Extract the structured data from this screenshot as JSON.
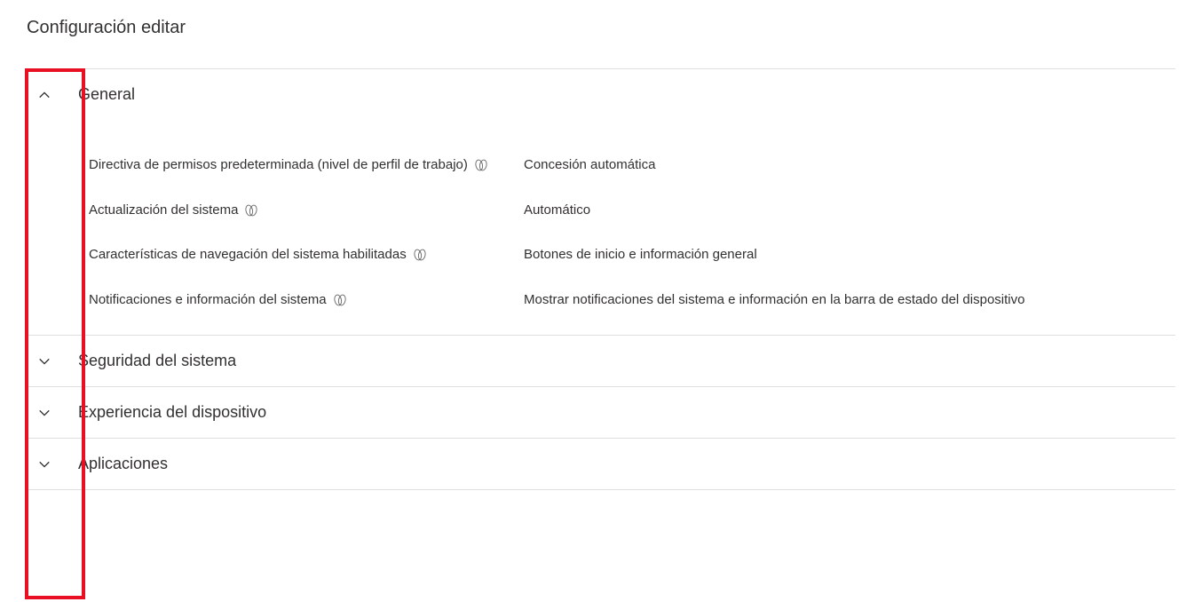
{
  "page": {
    "title": "Configuración editar"
  },
  "sections": {
    "general": {
      "title": "General",
      "expanded": true,
      "settings": [
        {
          "label": "Directiva de permisos predeterminada (nivel de perfil de trabajo)",
          "value": "Concesión automática",
          "hasCopilot": true
        },
        {
          "label": "Actualización del sistema",
          "value": "Automático",
          "hasCopilot": true
        },
        {
          "label": "Características de navegación del sistema habilitadas",
          "value": "Botones de inicio e información general",
          "hasCopilot": true
        },
        {
          "label": "Notificaciones e información del sistema",
          "value": "Mostrar notificaciones del sistema e información en la barra de estado del dispositivo",
          "hasCopilot": true
        }
      ]
    },
    "systemSecurity": {
      "title": "Seguridad del sistema",
      "expanded": false
    },
    "deviceExperience": {
      "title": "Experiencia del dispositivo",
      "expanded": false
    },
    "applications": {
      "title": "Aplicaciones",
      "expanded": false
    }
  }
}
